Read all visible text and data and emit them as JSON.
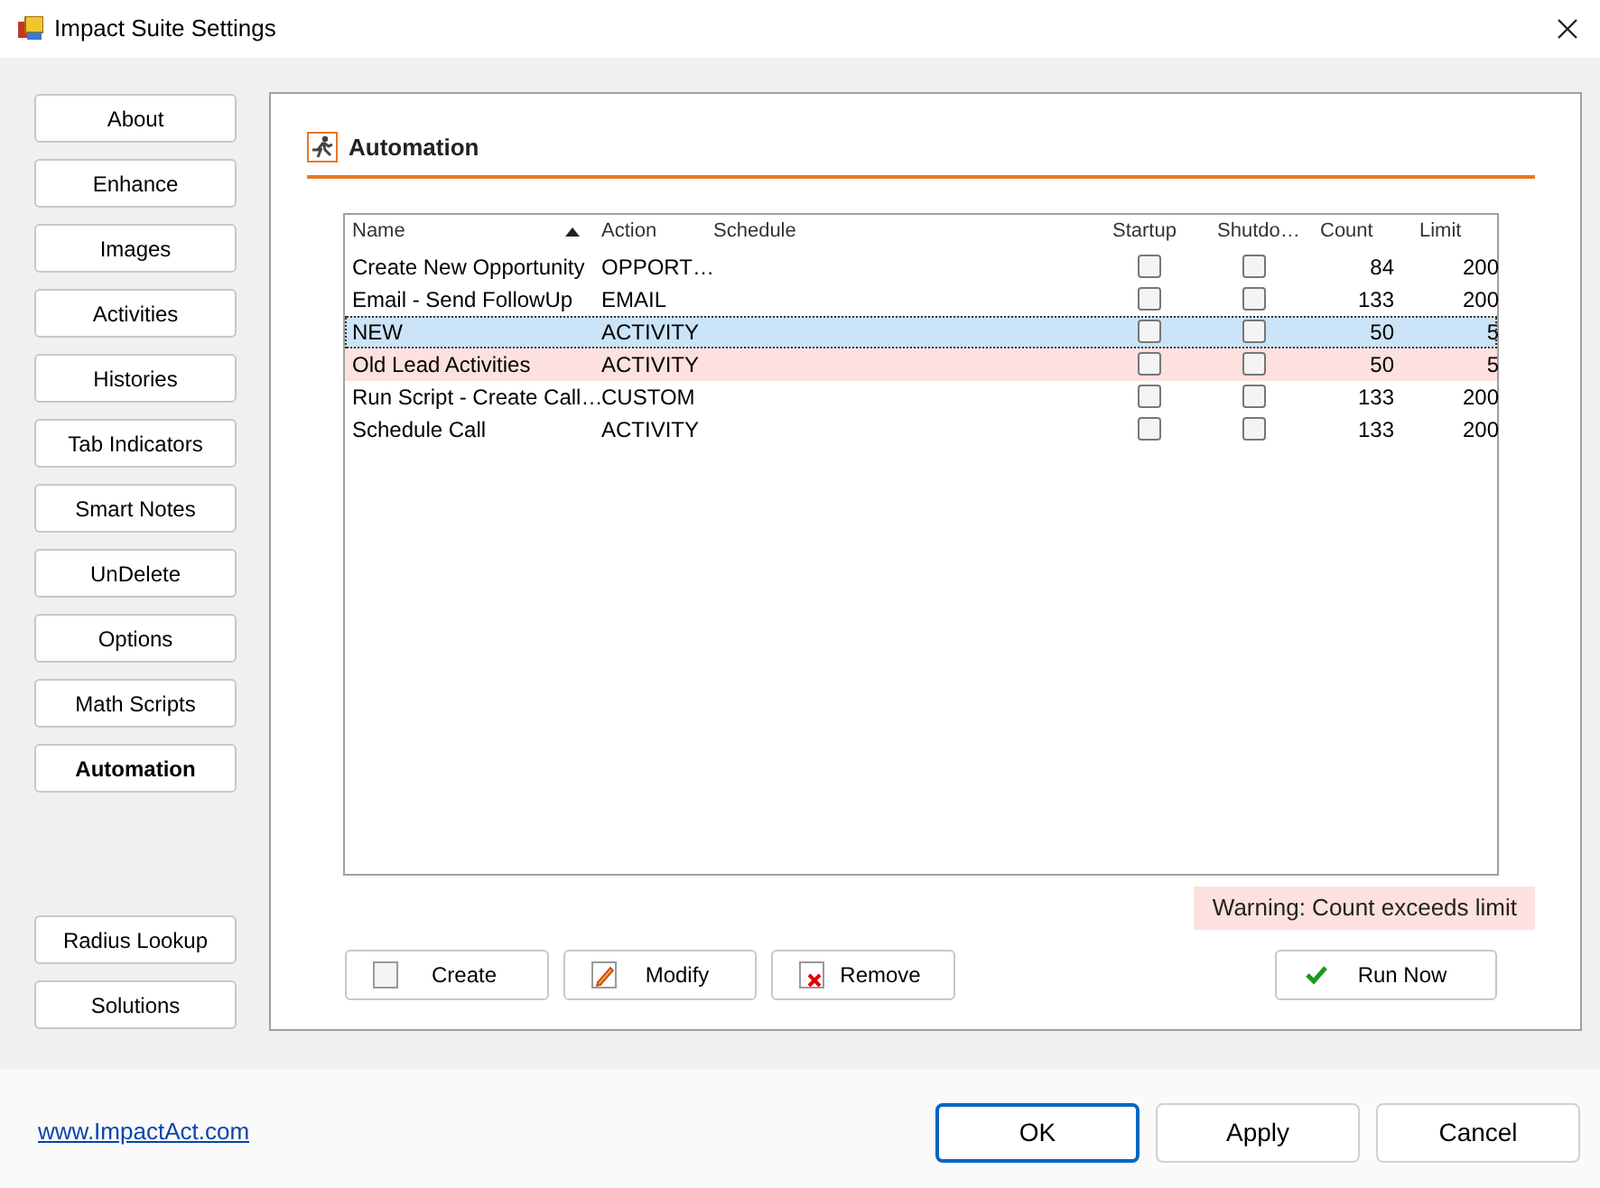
{
  "window": {
    "title": "Impact Suite Settings"
  },
  "sidebar": {
    "items": [
      {
        "label": "About",
        "selected": false
      },
      {
        "label": "Enhance",
        "selected": false
      },
      {
        "label": "Images",
        "selected": false
      },
      {
        "label": "Activities",
        "selected": false
      },
      {
        "label": "Histories",
        "selected": false
      },
      {
        "label": "Tab Indicators",
        "selected": false
      },
      {
        "label": "Smart Notes",
        "selected": false
      },
      {
        "label": "UnDelete",
        "selected": false
      },
      {
        "label": "Options",
        "selected": false
      },
      {
        "label": "Math Scripts",
        "selected": false
      },
      {
        "label": "Automation",
        "selected": true
      }
    ],
    "bottom_items": [
      {
        "label": "Radius Lookup",
        "selected": false
      },
      {
        "label": "Solutions",
        "selected": false
      }
    ]
  },
  "panel": {
    "title": "Automation"
  },
  "table": {
    "columns": [
      "Name",
      "Action",
      "Schedule",
      "Startup",
      "Shutdo…",
      "Count",
      "Limit"
    ],
    "rows": [
      {
        "name": "Create New Opportunity",
        "action": "OPPORT…",
        "startup": false,
        "shutdown": false,
        "count": "84",
        "limit": "200",
        "selected": false,
        "warning": false
      },
      {
        "name": "Email - Send FollowUp",
        "action": "EMAIL",
        "startup": false,
        "shutdown": false,
        "count": "133",
        "limit": "200",
        "selected": false,
        "warning": false
      },
      {
        "name": "NEW",
        "action": "ACTIVITY",
        "startup": false,
        "shutdown": false,
        "count": "50",
        "limit": "5",
        "selected": true,
        "warning": false
      },
      {
        "name": "Old Lead Activities",
        "action": "ACTIVITY",
        "startup": false,
        "shutdown": false,
        "count": "50",
        "limit": "5",
        "selected": false,
        "warning": true
      },
      {
        "name": "Run Script - Create Call…",
        "action": "CUSTOM",
        "startup": false,
        "shutdown": false,
        "count": "133",
        "limit": "200",
        "selected": false,
        "warning": false
      },
      {
        "name": "Schedule Call",
        "action": "ACTIVITY",
        "startup": false,
        "shutdown": false,
        "count": "133",
        "limit": "200",
        "selected": false,
        "warning": false
      }
    ]
  },
  "warning": "Warning: Count exceeds limit",
  "actions": [
    {
      "label": "Create",
      "kind": "create"
    },
    {
      "label": "Modify",
      "kind": "modify"
    },
    {
      "label": "Remove",
      "kind": "remove"
    }
  ],
  "run_button": "Run Now",
  "link": "www.ImpactAct.com",
  "buttons": [
    {
      "label": "OK",
      "selected": true
    },
    {
      "label": "Apply",
      "selected": false
    },
    {
      "label": "Cancel",
      "selected": false
    }
  ]
}
